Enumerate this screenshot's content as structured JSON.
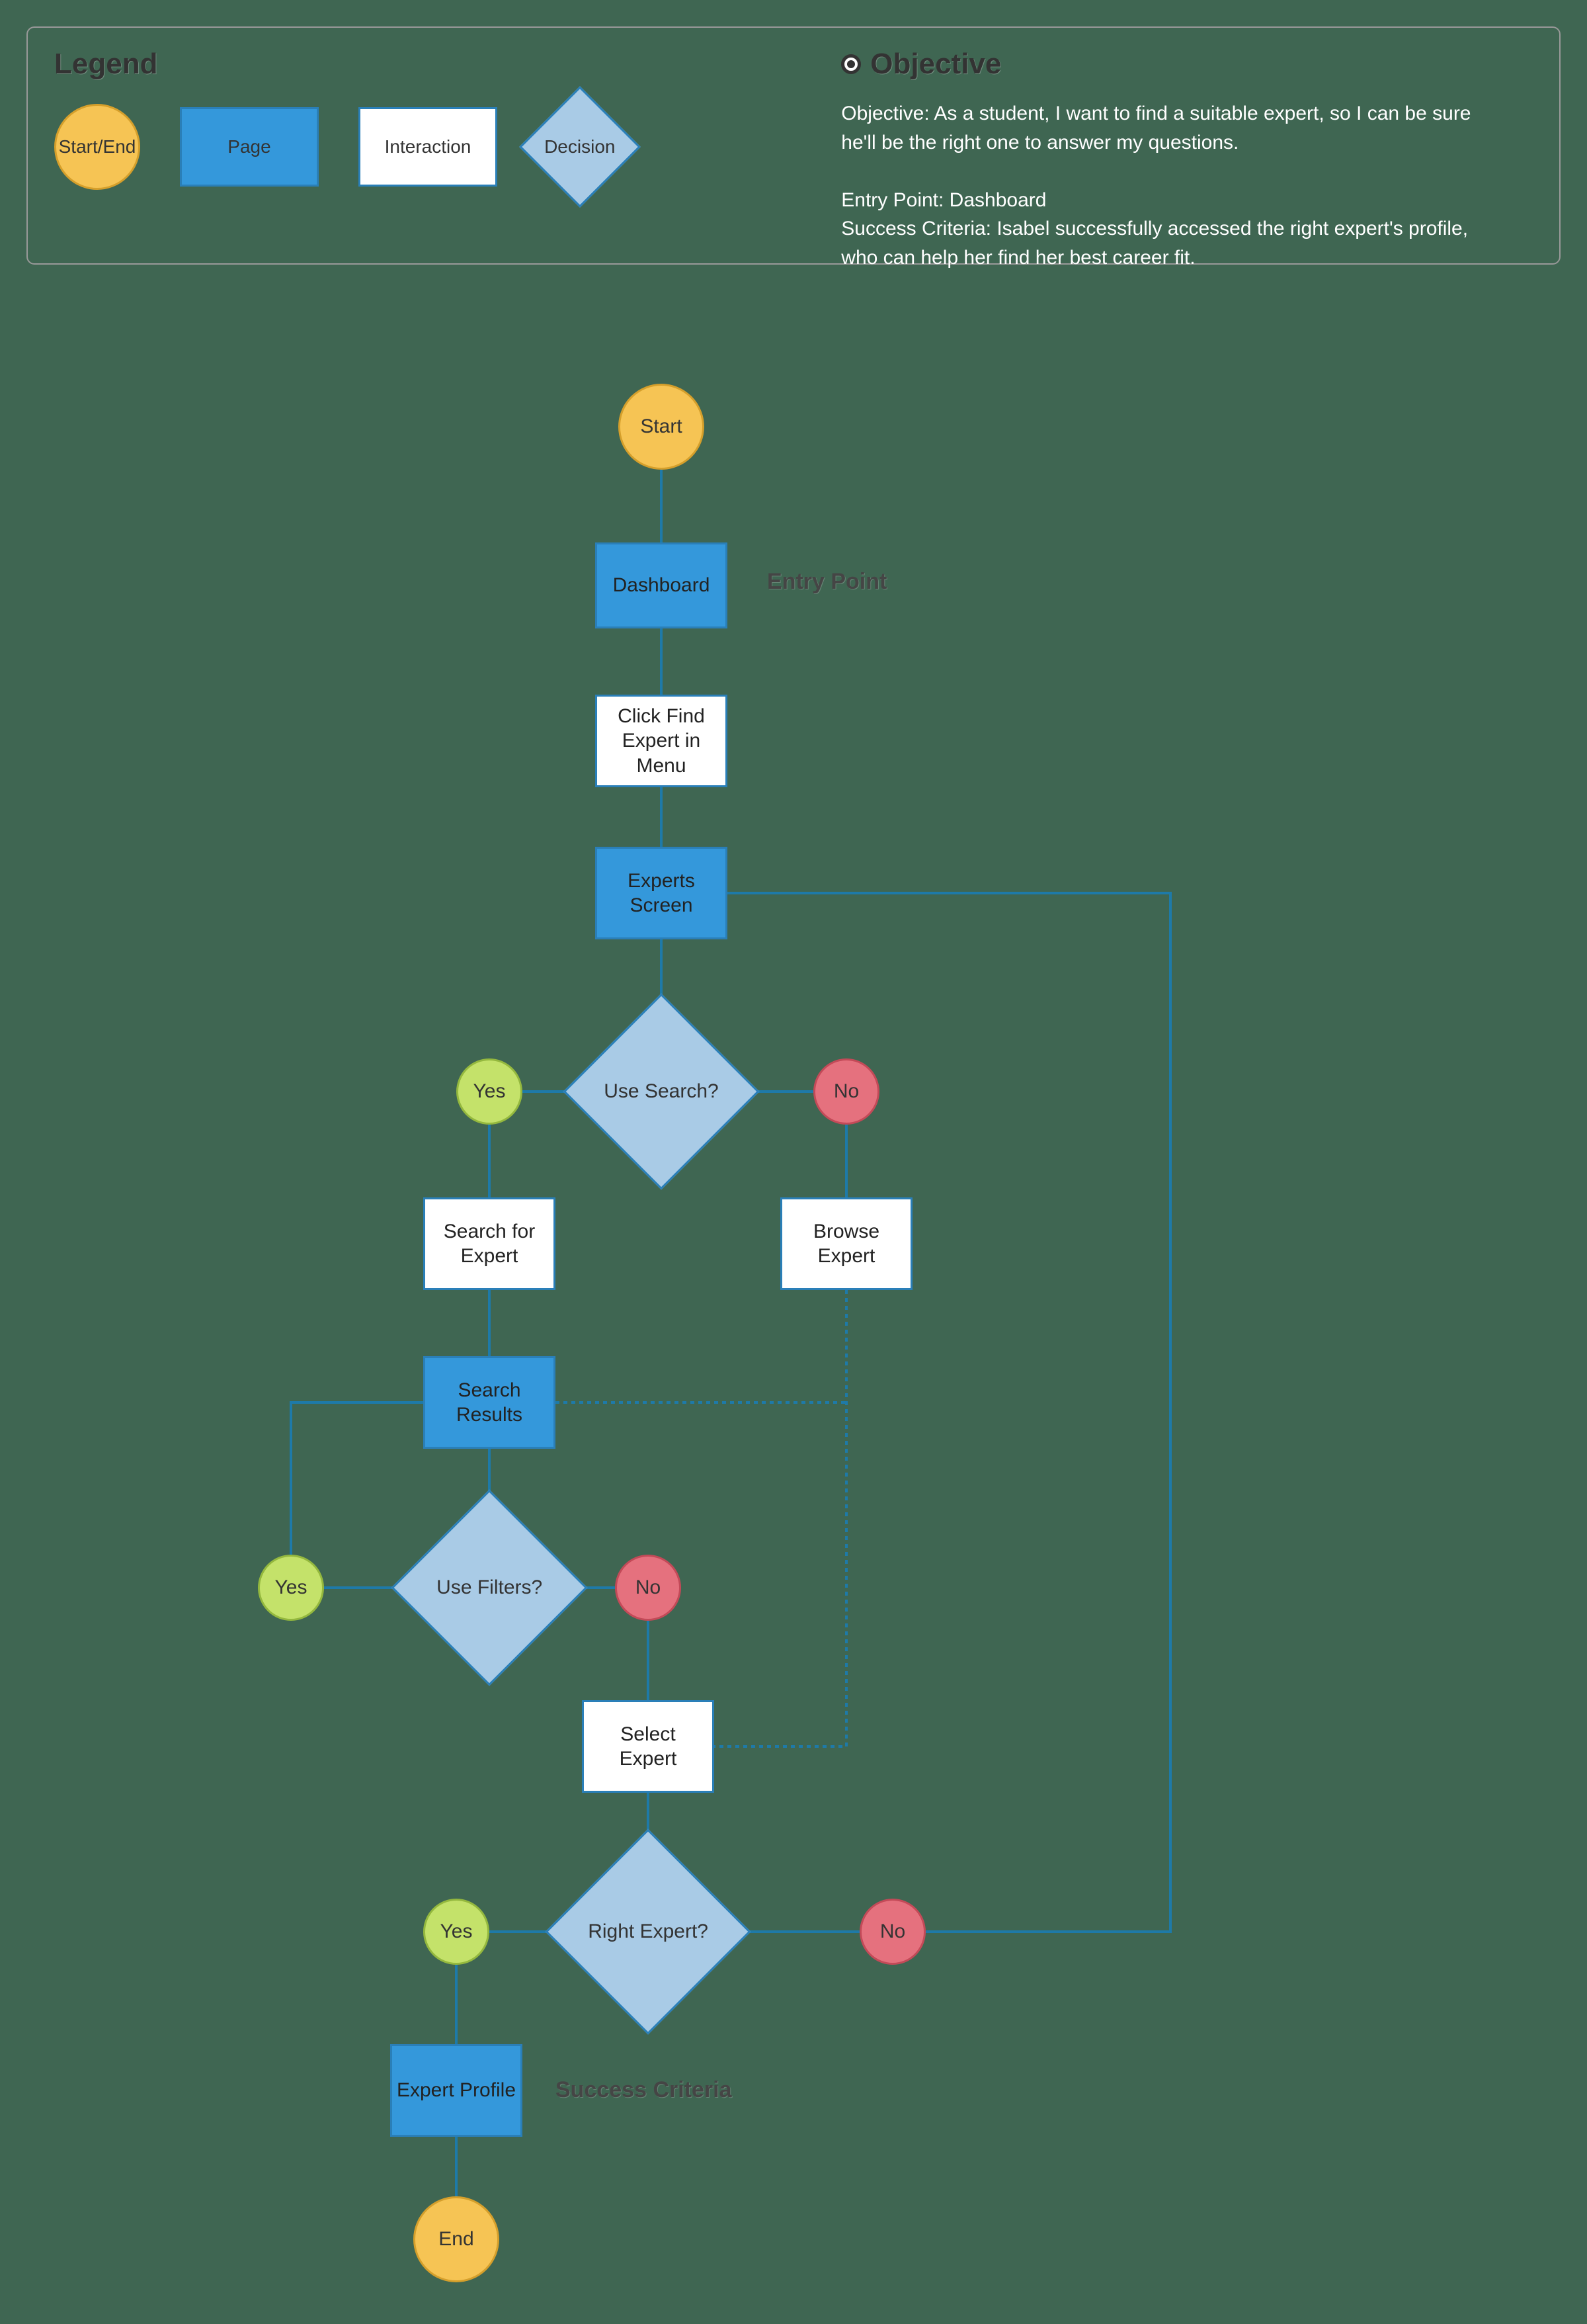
{
  "legend": {
    "title": "Legend",
    "start_end": "Start/End",
    "page": "Page",
    "interaction": "Interaction",
    "decision": "Decision"
  },
  "objective": {
    "title": "Objective",
    "body_l1": "Objective:   As a student, I want to find a suitable expert, so I can be sure",
    "body_l2": "he'll be the right one to answer my questions.",
    "entry": "Entry Point: Dashboard",
    "success_l1": "Success Criteria:  Isabel successfully accessed the right expert's profile,",
    "success_l2": "who can help her find her best career fit."
  },
  "annot": {
    "entry_point": "Entry Point",
    "success_criteria": "Success Criteria"
  },
  "nodes": {
    "start": "Start",
    "dashboard": "Dashboard",
    "click_find": "Click Find Expert in Menu",
    "experts_screen": "Experts Screen",
    "use_search": "Use Search?",
    "yes1": "Yes",
    "no1": "No",
    "search_for": "Search for Expert",
    "browse_expert": "Browse Expert",
    "search_results": "Search Results",
    "use_filters": "Use Filters?",
    "yes2": "Yes",
    "no2": "No",
    "select_expert": "Select Expert",
    "right_expert": "Right Expert?",
    "yes3": "Yes",
    "no3": "No",
    "expert_profile": "Expert Profile",
    "end": "End"
  }
}
